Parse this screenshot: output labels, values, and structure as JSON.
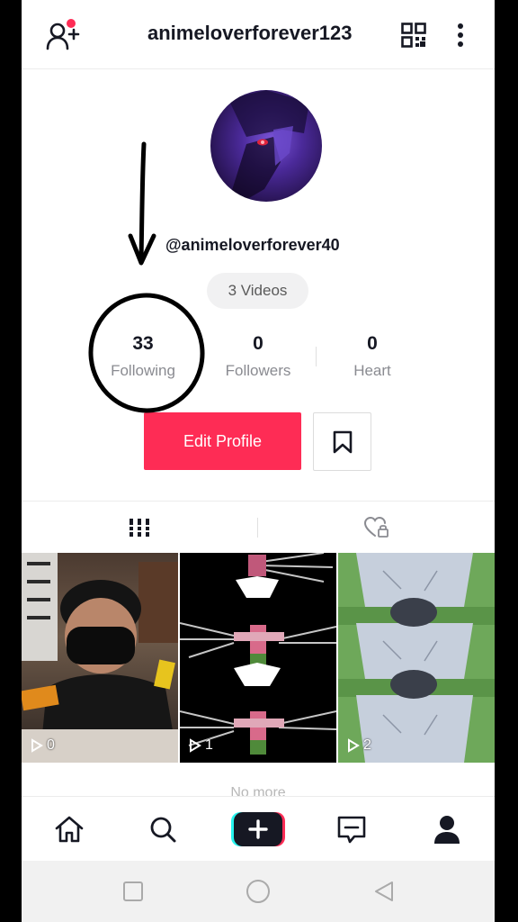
{
  "header": {
    "username": "animeloverforever123",
    "icons": [
      "add-friend-icon",
      "qr-code-icon",
      "more-options-icon"
    ]
  },
  "profile": {
    "handle": "@animeloverforever40",
    "videos_pill": "3 Videos",
    "stats": [
      {
        "value": "33",
        "label": "Following"
      },
      {
        "value": "0",
        "label": "Followers"
      },
      {
        "value": "0",
        "label": "Heart"
      }
    ],
    "edit_profile_label": "Edit Profile"
  },
  "tabs": [
    "videos-grid-icon",
    "liked-private-icon"
  ],
  "videos": [
    {
      "views": "0"
    },
    {
      "views": "1"
    },
    {
      "views": "2"
    }
  ],
  "footer_text": "No more",
  "bottom_nav": [
    "home-icon",
    "discover-icon",
    "create-icon",
    "inbox-icon",
    "profile-icon"
  ],
  "colors": {
    "accent": "#fe2c55",
    "create_left": "#25f4ee",
    "create_right": "#fe2c55",
    "text_primary": "#161823",
    "text_secondary": "#8a8b91"
  }
}
